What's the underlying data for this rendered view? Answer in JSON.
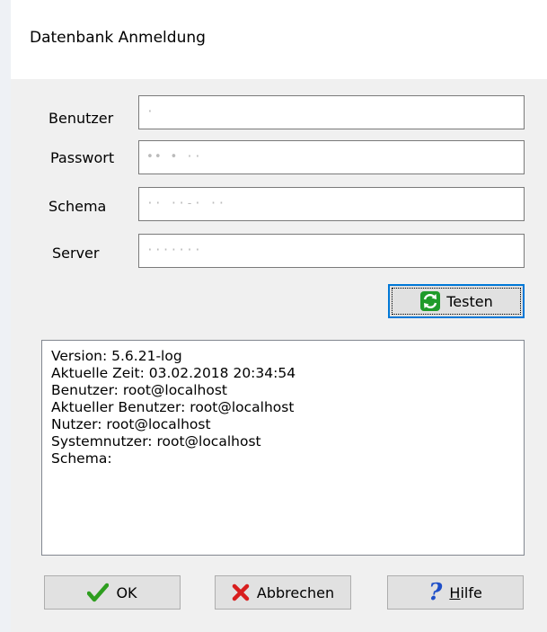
{
  "dialog": {
    "title": "Datenbank Anmeldung"
  },
  "fields": {
    "benutzer": {
      "label": "Benutzer",
      "value": "·"
    },
    "passwort": {
      "label": "Passwort",
      "value": "•• • ··"
    },
    "schema": {
      "label": "Schema",
      "value": "·· ··‐· ··"
    },
    "server": {
      "label": "Server",
      "value": "·······"
    }
  },
  "test_button": {
    "label": "Testen",
    "icon": "refresh-icon"
  },
  "output": {
    "lines": [
      "Version: 5.6.21-log",
      "Aktuelle Zeit: 03.02.2018 20:34:54",
      "Benutzer: root@localhost",
      "Aktueller Benutzer: root@localhost",
      "Nutzer: root@localhost",
      "Systemnutzer: root@localhost",
      "Schema:"
    ]
  },
  "buttons": {
    "ok": {
      "label": "OK",
      "icon": "checkmark-icon"
    },
    "cancel": {
      "label": "Abbrechen",
      "icon": "x-mark-icon"
    },
    "help": {
      "label": "Hilfe",
      "icon": "question-mark-icon"
    }
  },
  "colors": {
    "accent": "#0078d7",
    "ok_green": "#2e9e1f",
    "cancel_red": "#d81e1e",
    "help_blue": "#1e4fc8"
  }
}
